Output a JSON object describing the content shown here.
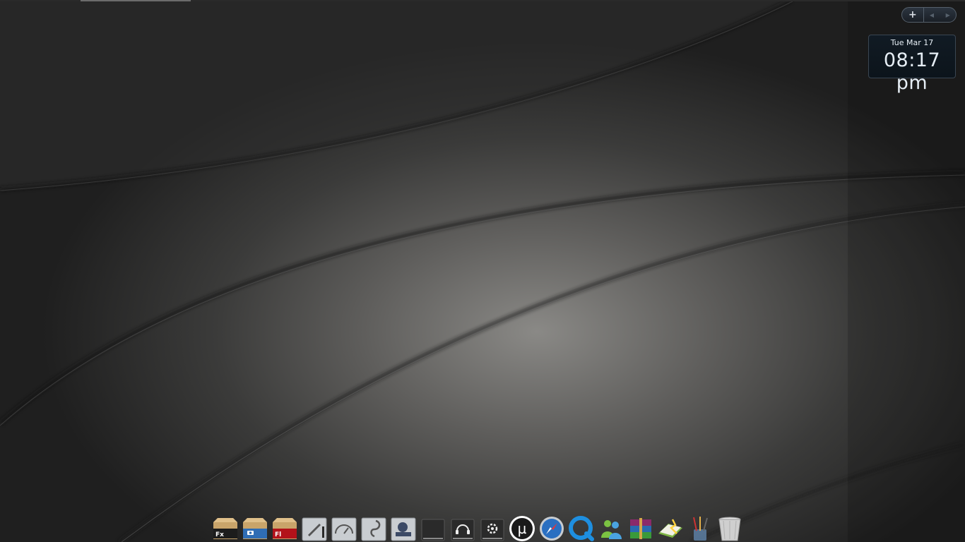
{
  "widget_controls": {
    "add_label": "+",
    "prev_icon": "triangle-left-icon",
    "next_icon": "triangle-right-icon"
  },
  "clock": {
    "date": "Tue Mar 17",
    "time": "08:17 pm"
  },
  "dock": {
    "items": [
      {
        "name": "firefox-box",
        "label": "Fx",
        "color": "#1c1c1c"
      },
      {
        "name": "camera-box",
        "label": "",
        "color": "#2f6db5"
      },
      {
        "name": "flash-box",
        "label": "Fl",
        "color": "#b3121a"
      },
      {
        "name": "pen-tool",
        "label": "",
        "color": "#c9cdd1"
      },
      {
        "name": "gauge-tool",
        "label": "",
        "color": "#c9cdd1"
      },
      {
        "name": "hook-tool",
        "label": "",
        "color": "#c9cdd1"
      },
      {
        "name": "finder-tool",
        "label": "",
        "color": "#c9cdd1"
      },
      {
        "name": "dark-drive",
        "label": "",
        "color": "#2a2a2a"
      },
      {
        "name": "headphones-drive",
        "label": "",
        "color": "#2a2a2a"
      },
      {
        "name": "gear-drive",
        "label": "",
        "color": "#2a2a2a"
      },
      {
        "name": "utorrent",
        "label": "µ",
        "color": "#1a1a1a"
      },
      {
        "name": "safari",
        "label": "",
        "color": "#2a6fc1"
      },
      {
        "name": "quicktime",
        "label": "",
        "color": "#1e8fe0"
      },
      {
        "name": "messenger",
        "label": "",
        "color": "#4aa3e0"
      },
      {
        "name": "winrar",
        "label": "",
        "color": "#8b2a6a"
      },
      {
        "name": "notebook",
        "label": "",
        "color": "#7cb342"
      },
      {
        "name": "brushes",
        "label": "",
        "color": "#5d7fa3"
      },
      {
        "name": "trash",
        "label": "",
        "color": "#c9c9c9"
      }
    ]
  }
}
